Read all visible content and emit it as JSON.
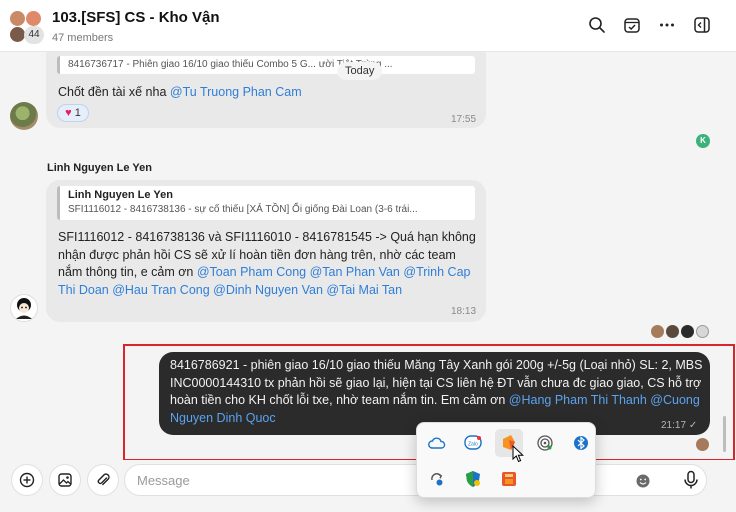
{
  "header": {
    "title": "103.[SFS] CS - Kho Vận",
    "members": "47 members",
    "member_count_badge": "44"
  },
  "chat": {
    "today_label": "Today",
    "msg1": {
      "quote_text": "8416736717 - Phiên giao 16/10 giao thiếu Combo 5 G... ười Tiệt Trùng ...",
      "text": "Chốt đền tài xế nha ",
      "mention": "@Tu Truong Phan Cam",
      "reaction_count": "1",
      "time": "17:55"
    },
    "reader_badge": "K",
    "msg2": {
      "sender": "Linh Nguyen Le Yen",
      "quote_name": "Linh Nguyen Le Yen",
      "quote_text": "SFI1116012 - 8416738136 - sự cố thiếu [XẢ TỒN] Ổi giống Đài Loan (3-6 trái...",
      "text": "SFI1116012 - 8416738136 và SFI1116010 - 8416781545 -> Quá hạn không nhận được phản hồi CS sẽ xử lí hoàn tiền đơn hàng trên, nhờ các team nắm thông tin, e cảm ơn ",
      "mentions": [
        "@Toan Pham Cong",
        "@Tan Phan Van",
        "@Trinh Cap Thi Doan",
        "@Hau Tran Cong",
        "@Dinh Nguyen Van",
        "@Tai Mai Tan"
      ],
      "time": "18:13"
    },
    "msg3": {
      "text": "8416786921 - phiên giao 16/10 giao thiếu Măng Tây Xanh gói 200g +/-5g (Loại nhỏ) SL: 2, MBS INC0000144310 tx phản hồi sẽ giao lại, hiện tại CS liên hệ ĐT vẫn chưa đc giao giao, CS hỗ trợ hoàn tiền cho KH chốt lỗi txe, nhờ team nắm tin. Em cảm ơn ",
      "mentions": [
        "@Hang Pham Thi Thanh",
        "@Cuong Nguyen Dinh Quoc"
      ],
      "time": "21:17"
    }
  },
  "composer": {
    "placeholder": "Message"
  },
  "tray": {
    "icons": [
      "onedrive-icon",
      "zalo-icon",
      "app-icon",
      "fingerprint-icon",
      "bluetooth-icon",
      "sync-icon",
      "security-icon",
      "task-icon"
    ]
  },
  "colors": {
    "accent_mention": "#2f7ed8",
    "highlight_box": "#d9262c",
    "own_bubble": "#2b2b2b"
  }
}
